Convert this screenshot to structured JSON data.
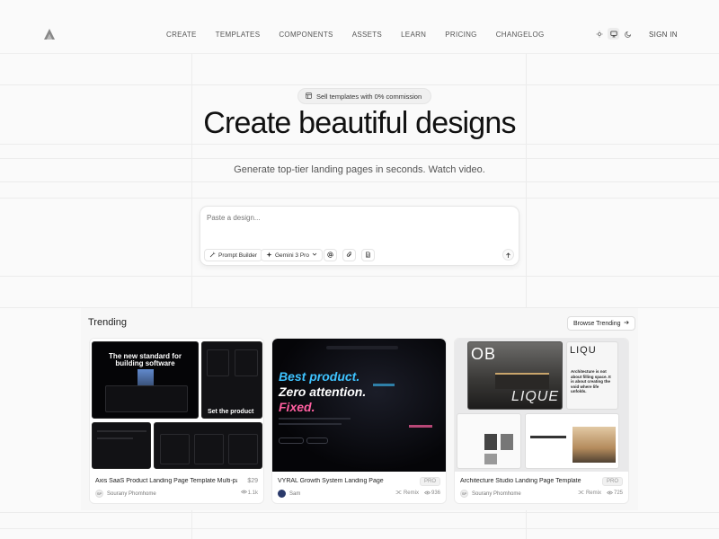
{
  "nav": {
    "items": [
      "CREATE",
      "TEMPLATES",
      "COMPONENTS",
      "ASSETS",
      "LEARN",
      "PRICING",
      "CHANGELOG"
    ],
    "signin": "SIGN IN"
  },
  "theme": {
    "icons": [
      "sun-icon",
      "monitor-icon",
      "moon-icon"
    ],
    "active": "monitor-icon"
  },
  "hero": {
    "pill": "Sell templates with 0% commission",
    "title": "Create beautiful designs",
    "subtitle": "Generate top-tier landing pages in seconds.  Watch video."
  },
  "prompt": {
    "placeholder": "Paste a design...",
    "prompt_builder": "Prompt Builder",
    "model": "Gemini 3 Pro"
  },
  "trending": {
    "title": "Trending",
    "browse": "Browse Trending",
    "cards": [
      {
        "title": "Axis SaaS Product Landing Page Template Multi-pa...",
        "price": "$29",
        "author_initials": "SP",
        "author": "Sourany Phomhome",
        "views": "1.1k",
        "thumb_headline": "The new standard for building software",
        "thumb_sub": "Set the product"
      },
      {
        "title": "VYRAL Growth System Landing Page",
        "badge": "PRO",
        "author": "Sam",
        "remix": "Remix",
        "views": "936",
        "thumb_line1": "Best product.",
        "thumb_line2": "Zero attention.",
        "thumb_line3": "Fixed."
      },
      {
        "title": "Architecture Studio Landing Page Template",
        "badge": "PRO",
        "author_initials": "SP",
        "author": "Sourany Phomhome",
        "remix": "Remix",
        "views": "725",
        "thumb_ob": "OB",
        "thumb_lique": "LIQUE",
        "thumb_lique2": "LIQU",
        "thumb_note": "Architecture is not about filling space. It is about creating the void where life unfolds."
      }
    ]
  },
  "colors": {
    "accent": "#111111",
    "bg": "#fafafa",
    "neon_blue": "#3ec3ff",
    "neon_pink": "#ff5fa0"
  }
}
